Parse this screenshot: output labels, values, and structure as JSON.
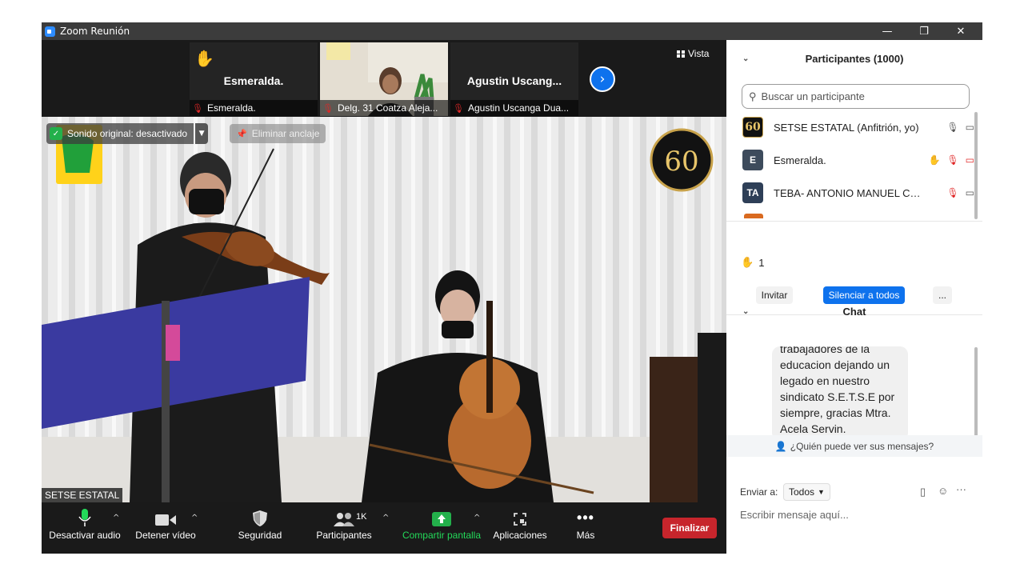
{
  "window": {
    "title": "Zoom Reunión",
    "minimize": "—",
    "restore": "❐",
    "close": "✕"
  },
  "strip": {
    "tiles": [
      {
        "name": "Esmeralda.",
        "footer": "Esmeralda.",
        "hand": "✋"
      },
      {
        "name": "",
        "footer": "Delg. 31 Coatza Aleja..."
      },
      {
        "name": "Agustin  Uscang...",
        "footer": "Agustin Uscanga Dua..."
      }
    ],
    "next": "›",
    "view_label": "Vista"
  },
  "stage": {
    "original_sound": "Sonido original: desactivado",
    "unpin": "Eliminar anclaje",
    "speaker_label": "SETSE ESTATAL",
    "badge_text": "60"
  },
  "toolbar": {
    "mute": "Desactivar audio",
    "video": "Detener vídeo",
    "security": "Seguridad",
    "participants": "Participantes",
    "participants_count": "1K",
    "share": "Compartir pantalla",
    "apps": "Aplicaciones",
    "more": "Más",
    "end": "Finalizar"
  },
  "participants": {
    "title": "Participantes (1000)",
    "search_placeholder": "Buscar un participante",
    "list": [
      {
        "initials": "60",
        "name": "SETSE ESTATAL (Anfitrión, yo)",
        "color": "#111111"
      },
      {
        "initials": "E",
        "name": "Esmeralda.",
        "color": "#3d4b5c"
      },
      {
        "initials": "TA",
        "name": "TEBA- ANTONIO MANUEL CO...",
        "color": "#2e3f57"
      }
    ],
    "raised_hands": "1",
    "invite": "Invitar",
    "mute_all": "Silenciar a todos",
    "more": "..."
  },
  "chat": {
    "title": "Chat",
    "message_lines": [
      "trabajadores de la",
      "educacion dejando un",
      "legado en nuestro",
      "sindicato S.E.T.S.E por",
      "siempre, gracias Mtra.",
      "Acela Servin."
    ],
    "who_can_see": "¿Quién puede ver sus mensajes?",
    "send_to_label": "Enviar a:",
    "send_to_value": "Todos",
    "input_placeholder": "Escribir mensaje aquí..."
  },
  "colors": {
    "accent": "#0e72ed",
    "end": "#c7252c",
    "share": "#23b04b",
    "mic": "#23d959"
  }
}
